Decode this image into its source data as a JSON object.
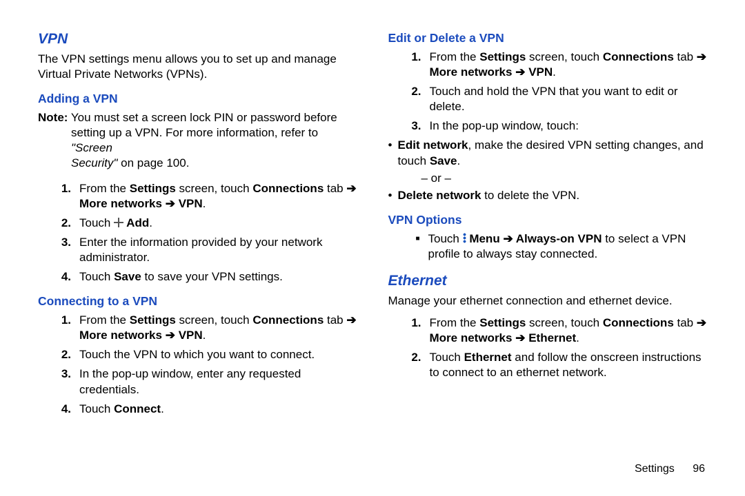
{
  "left": {
    "h_vpn": "VPN",
    "vpn_intro": "The VPN settings menu allows you to set up and manage Virtual Private Networks (VPNs).",
    "h_adding": "Adding a VPN",
    "note_lead": "Note:",
    "note1a": " You must set a screen lock PIN or password before",
    "note1b": "setting up a VPN. For more information, refer to ",
    "note_ref_a": "\"Screen",
    "note_ref_b": "Security\"",
    "note_page": " on page 100.",
    "add1_a": "From the ",
    "settings": "Settings",
    "add1_b": " screen, touch ",
    "connections": "Connections",
    "add1_c": " tab ",
    "more_net": "More networks",
    "vpn_bold": "VPN",
    "period": ".",
    "add2_a": "Touch ",
    "add2_b": " Add",
    "add3": "Enter the information provided by your network administrator.",
    "add4_a": "Touch ",
    "save_b": "Save",
    "add4_b": " to save your VPN settings.",
    "h_connecting": "Connecting to a VPN",
    "con2": "Touch the VPN to which you want to connect.",
    "con3": "In the pop-up window, enter any requested credentials.",
    "con4_a": "Touch ",
    "connect_b": "Connect"
  },
  "right": {
    "h_edit": "Edit or Delete a VPN",
    "ed2": "Touch and hold the VPN that you want to edit or delete.",
    "ed3": "In the pop-up window, touch:",
    "ed3a_a": "Edit network",
    "ed3a_b": ", make the desired VPN setting changes, and touch ",
    "ed3a_c": "Save",
    "or": "– or –",
    "ed3b_a": "Delete network",
    "ed3b_b": " to delete the VPN.",
    "h_options": "VPN Options",
    "opt_a": "Touch ",
    "opt_menu": " Menu ",
    "opt_always": " Always-on VPN",
    "opt_b": " to select a VPN profile to always stay connected.",
    "h_eth": "Ethernet",
    "eth_intro": "Manage your ethernet connection and ethernet device.",
    "eth_bold": "Ethernet",
    "eth2_a": "Touch ",
    "eth2_b": " and follow the onscreen instructions to connect to an ethernet network."
  },
  "arrow": "➔",
  "footer": {
    "section": "Settings",
    "page": "96"
  }
}
